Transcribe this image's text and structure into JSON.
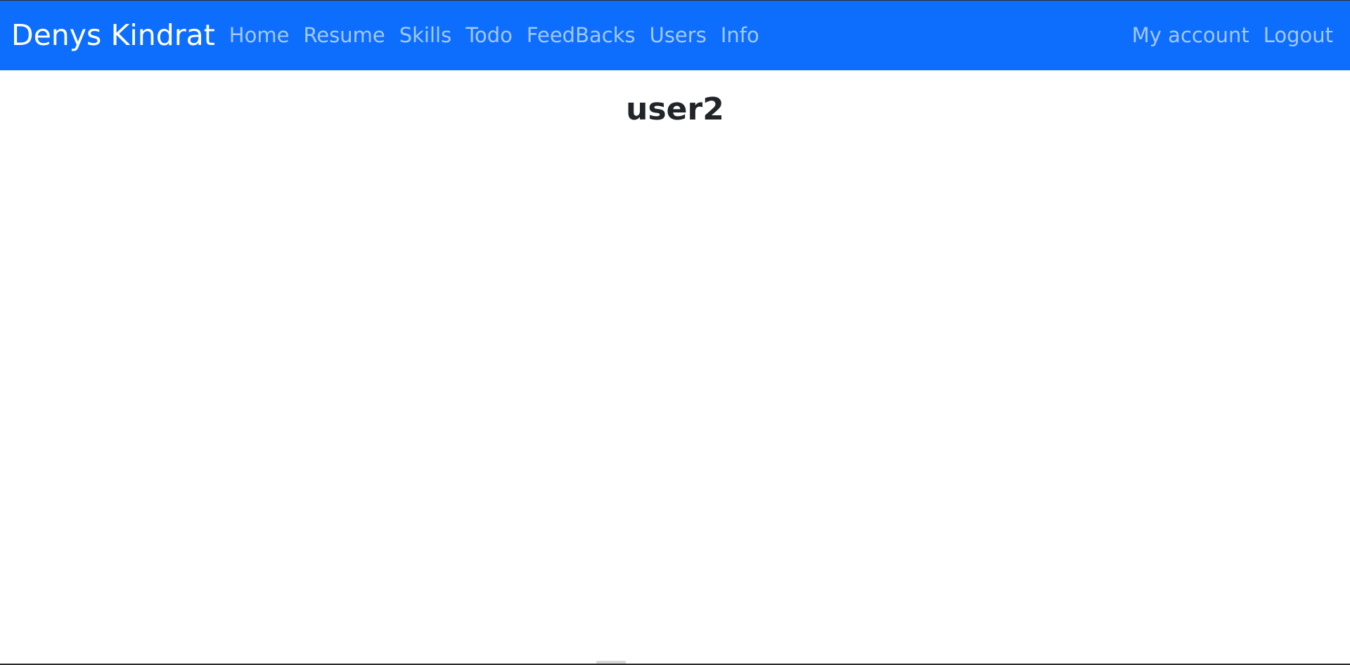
{
  "navbar": {
    "brand": "Denys Kindrat",
    "links": [
      "Home",
      "Resume",
      "Skills",
      "Todo",
      "FeedBacks",
      "Users",
      "Info"
    ],
    "right_links": [
      "My account",
      "Logout"
    ],
    "background_color": "#0d6efd"
  },
  "main": {
    "title": "user2"
  }
}
